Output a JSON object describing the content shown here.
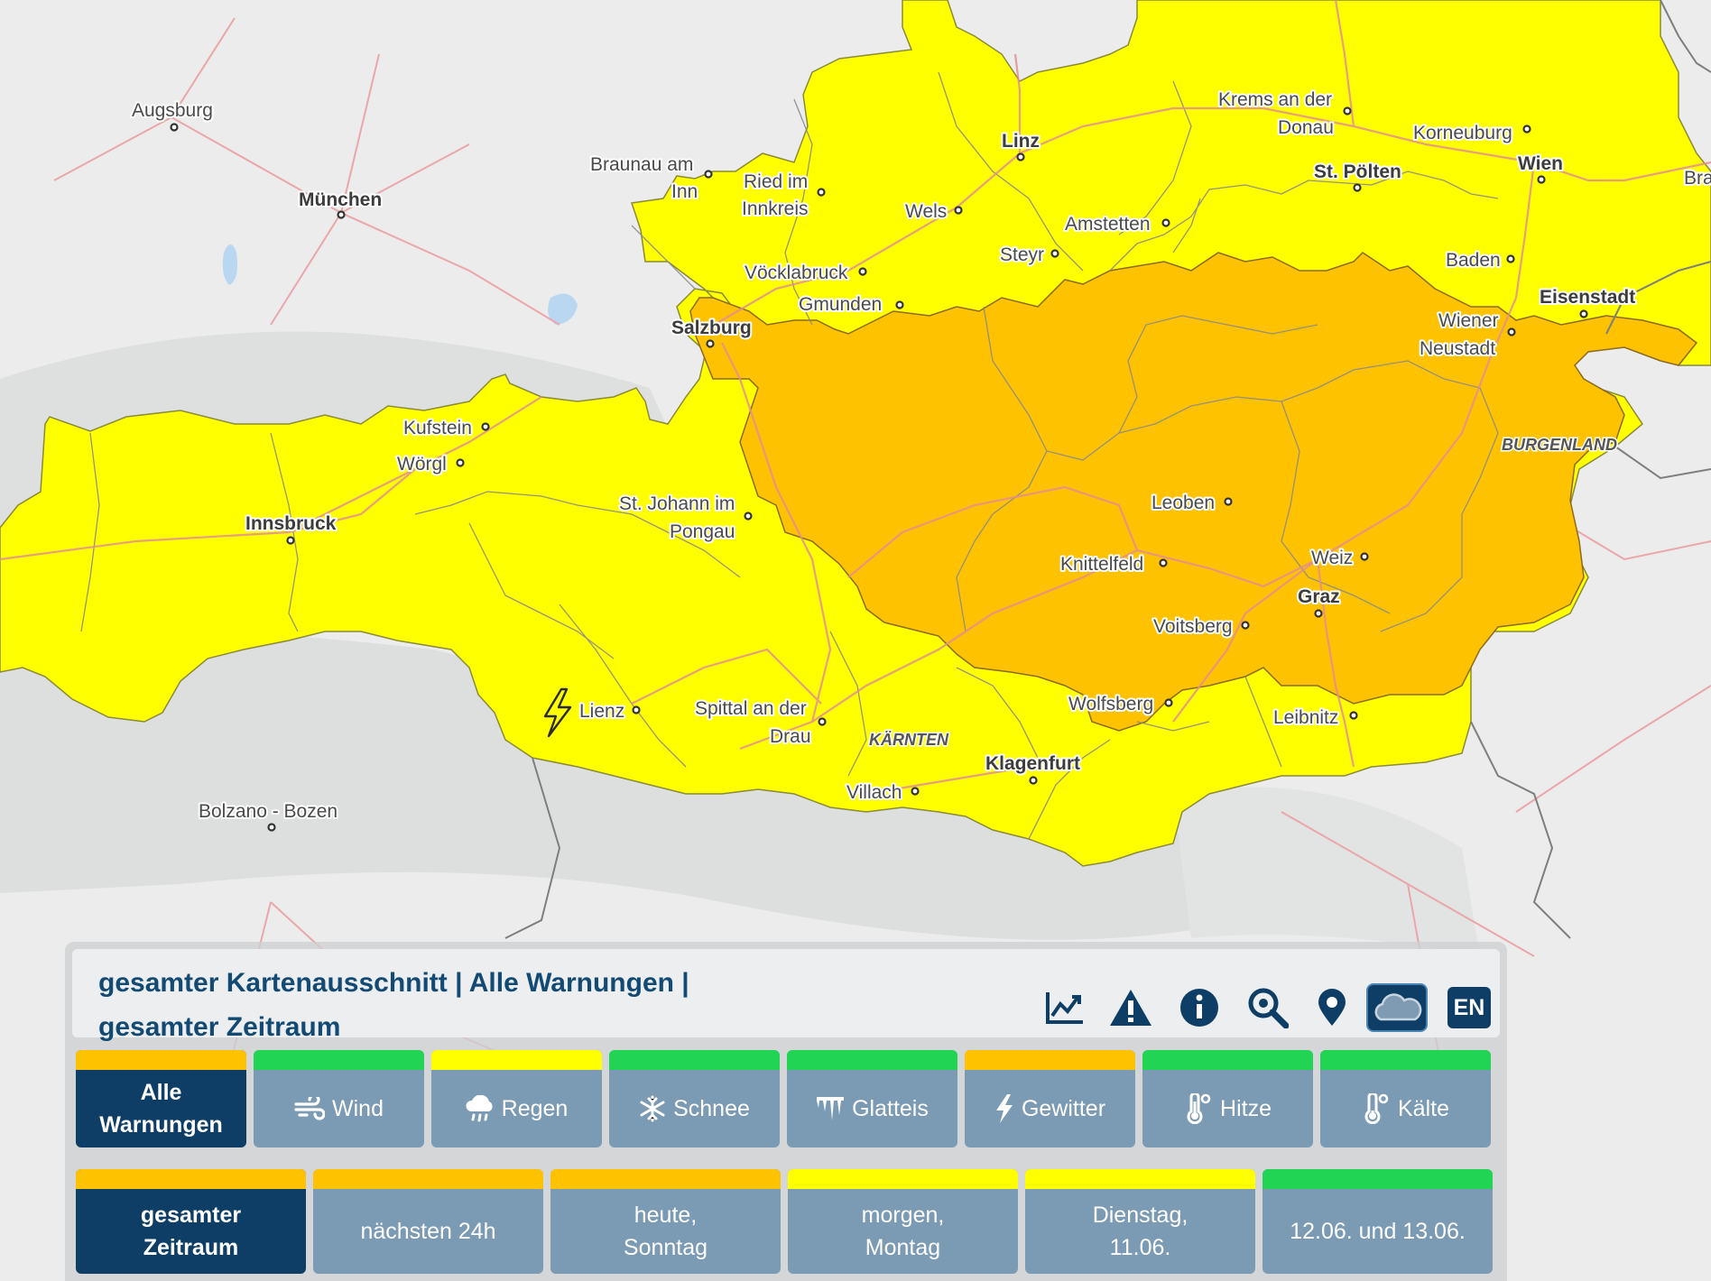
{
  "map": {
    "colors": {
      "background": "#e9eaea",
      "yellow_warning": "#ffff00",
      "orange_warning": "#ffc200",
      "roads": "#e8a3a6",
      "borders": "#7c7c7c"
    },
    "cities": [
      "Augsburg",
      "München",
      "Braunau am",
      "Inn",
      "Ried im",
      "Innkreis",
      "Linz",
      "Wels",
      "Steyr",
      "Amstetten",
      "Krems an der",
      "Donau",
      "Korneuburg",
      "Wien",
      "Bra",
      "St. Pölten",
      "Baden",
      "Eisenstadt",
      "Wiener",
      "Neustadt",
      "Vöcklabruck",
      "Gmunden",
      "Salzburg",
      "Kufstein",
      "Wörgl",
      "Innsbruck",
      "St. Johann im",
      "Pongau",
      "Leoben",
      "Knittelfeld",
      "Weiz",
      "Graz",
      "Voitsberg",
      "Wolfsberg",
      "Leibnitz",
      "Lienz",
      "Spittal an der",
      "Drau",
      "Klagenfurt",
      "Villach",
      "Bolzano - Bozen"
    ],
    "region_labels": [
      "BURGENLAND",
      "KÄRNTEN"
    ],
    "storm_marker_icon": "lightning-icon"
  },
  "panel": {
    "title": "gesamter Kartenausschnitt | Alle Warnungen | gesamter Zeitraum",
    "tools": [
      "chart-icon",
      "warning-icon",
      "info-icon",
      "zoom-search-icon",
      "location-pin-icon",
      "cloud-icon"
    ],
    "language_button": "EN",
    "categories": [
      {
        "label": "Alle Warnungen",
        "status_color": "#ffc200",
        "selected": true,
        "icon": ""
      },
      {
        "label": "Wind",
        "status_color": "#22d454",
        "selected": false,
        "icon": "wind-icon"
      },
      {
        "label": "Regen",
        "status_color": "#ffff00",
        "selected": false,
        "icon": "rain-icon"
      },
      {
        "label": "Schnee",
        "status_color": "#22d454",
        "selected": false,
        "icon": "snowflake-icon"
      },
      {
        "label": "Glatteis",
        "status_color": "#22d454",
        "selected": false,
        "icon": "ice-icon"
      },
      {
        "label": "Gewitter",
        "status_color": "#ffc200",
        "selected": false,
        "icon": "lightning-icon"
      },
      {
        "label": "Hitze",
        "status_color": "#22d454",
        "selected": false,
        "icon": "heat-thermometer-icon"
      },
      {
        "label": "Kälte",
        "status_color": "#22d454",
        "selected": false,
        "icon": "cold-thermometer-icon"
      }
    ],
    "timeframes": [
      {
        "line1": "gesamter",
        "line2": "Zeitraum",
        "status_color": "#ffc200",
        "selected": true
      },
      {
        "line1": "nächsten 24h",
        "line2": "",
        "status_color": "#ffc200",
        "selected": false
      },
      {
        "line1": "heute,",
        "line2": "Sonntag",
        "status_color": "#ffc200",
        "selected": false
      },
      {
        "line1": "morgen,",
        "line2": "Montag",
        "status_color": "#ffff00",
        "selected": false
      },
      {
        "line1": "Dienstag,",
        "line2": "11.06.",
        "status_color": "#ffff00",
        "selected": false
      },
      {
        "line1": "12.06. und 13.06.",
        "line2": "",
        "status_color": "#22d454",
        "selected": false
      }
    ]
  }
}
